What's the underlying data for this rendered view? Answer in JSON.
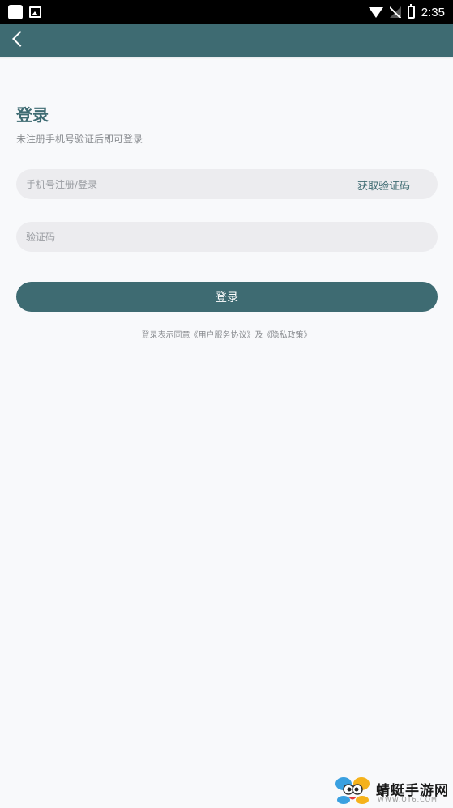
{
  "status_bar": {
    "time": "2:35",
    "icons": [
      "app-square-icon",
      "image-icon",
      "wifi-icon",
      "signal-off-icon",
      "battery-charging-icon"
    ]
  },
  "app_bar": {
    "background": "#3e6b72",
    "back_icon": "chevron-left-icon"
  },
  "login": {
    "title": "登录",
    "subtitle": "未注册手机号验证后即可登录",
    "phone_placeholder": "手机号注册/登录",
    "get_code_label": "获取验证码",
    "code_placeholder": "验证码",
    "login_button_label": "登录",
    "agreement_prefix": "登录表示同意",
    "user_agreement": "《用户服务协议》",
    "agreement_joiner": "及",
    "privacy_policy": "《隐私政策》"
  },
  "watermark": {
    "title": "蜻蜓手游网",
    "url": "WWW.QT6.COM"
  },
  "colors": {
    "accent": "#3e6b72",
    "background": "#f8f9fb",
    "field_background": "#ececef"
  }
}
